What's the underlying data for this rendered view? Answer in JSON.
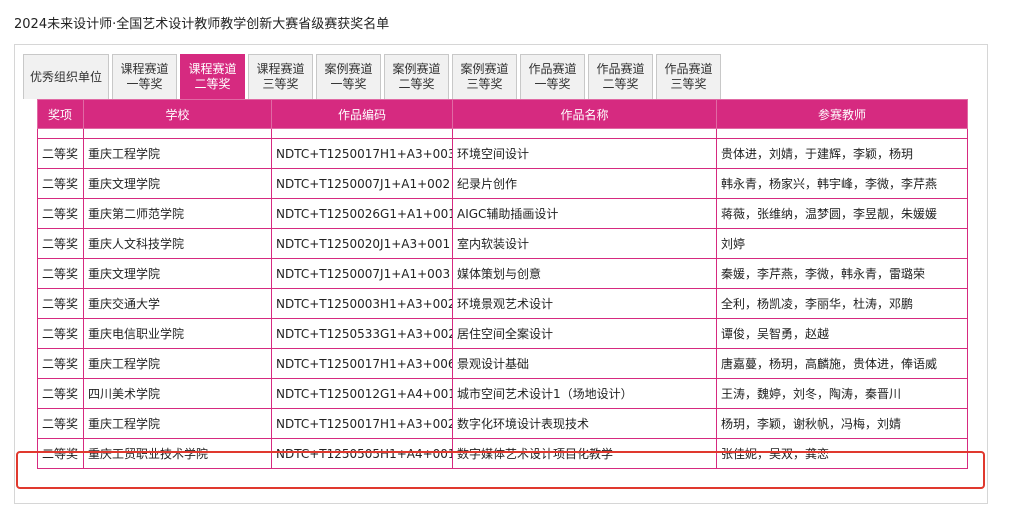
{
  "page_title": "2024未来设计师·全国艺术设计教师教学创新大赛省级赛获奖名单",
  "tabs": [
    {
      "line1": "优秀组织单位",
      "line2": "",
      "active": false
    },
    {
      "line1": "课程赛道",
      "line2": "一等奖",
      "active": false
    },
    {
      "line1": "课程赛道",
      "line2": "二等奖",
      "active": true
    },
    {
      "line1": "课程赛道",
      "line2": "三等奖",
      "active": false
    },
    {
      "line1": "案例赛道",
      "line2": "一等奖",
      "active": false
    },
    {
      "line1": "案例赛道",
      "line2": "二等奖",
      "active": false
    },
    {
      "line1": "案例赛道",
      "line2": "三等奖",
      "active": false
    },
    {
      "line1": "作品赛道",
      "line2": "一等奖",
      "active": false
    },
    {
      "line1": "作品赛道",
      "line2": "二等奖",
      "active": false
    },
    {
      "line1": "作品赛道",
      "line2": "三等奖",
      "active": false
    }
  ],
  "columns": [
    "奖项",
    "学校",
    "作品编码",
    "作品名称",
    "参赛教师"
  ],
  "rows": [
    [
      "二等奖",
      "重庆工程学院",
      "NDTC+T1250017H1+A3+003",
      "环境空间设计",
      "贵体进，刘婧，于建辉，李颖，杨玥"
    ],
    [
      "二等奖",
      "重庆文理学院",
      "NDTC+T1250007J1+A1+002",
      "纪录片创作",
      "韩永青，杨家兴，韩宇峰，李微，李芹燕"
    ],
    [
      "二等奖",
      "重庆第二师范学院",
      "NDTC+T1250026G1+A1+001",
      "AIGC辅助插画设计",
      "蒋薇，张维纳，温梦圆，李昱靓，朱媛媛"
    ],
    [
      "二等奖",
      "重庆人文科技学院",
      "NDTC+T1250020J1+A3+001",
      "室内软装设计",
      "刘婷"
    ],
    [
      "二等奖",
      "重庆文理学院",
      "NDTC+T1250007J1+A1+003",
      "媒体策划与创意",
      "秦媛，李芹燕，李微，韩永青，雷璐荣"
    ],
    [
      "二等奖",
      "重庆交通大学",
      "NDTC+T1250003H1+A3+002",
      "环境景观艺术设计",
      "全利，杨凯凌，李丽华，杜涛，邓鹏"
    ],
    [
      "二等奖",
      "重庆电信职业学院",
      "NDTC+T1250533G1+A3+002",
      "居住空间全案设计",
      "谭俊，吴智勇，赵越"
    ],
    [
      "二等奖",
      "重庆工程学院",
      "NDTC+T1250017H1+A3+006",
      "景观设计基础",
      "唐嘉蔓，杨玥，高麟施，贵体进，俸语威"
    ],
    [
      "二等奖",
      "四川美术学院",
      "NDTC+T1250012G1+A4+001",
      "城市空间艺术设计1（场地设计）",
      "王涛，魏婷，刘冬，陶涛，秦晋川"
    ],
    [
      "二等奖",
      "重庆工程学院",
      "NDTC+T1250017H1+A3+002",
      "数字化环境设计表现技术",
      "杨玥，李颖，谢秋帆，冯梅，刘婧"
    ],
    [
      "二等奖",
      "重庆工贸职业技术学院",
      "NDTC+T1250505H1+A4+001",
      "数字媒体艺术设计项目化教学",
      "张佳妮，吴双，龚恋"
    ]
  ],
  "colors": {
    "accent": "#d62a80",
    "highlight": "#e0392e"
  }
}
